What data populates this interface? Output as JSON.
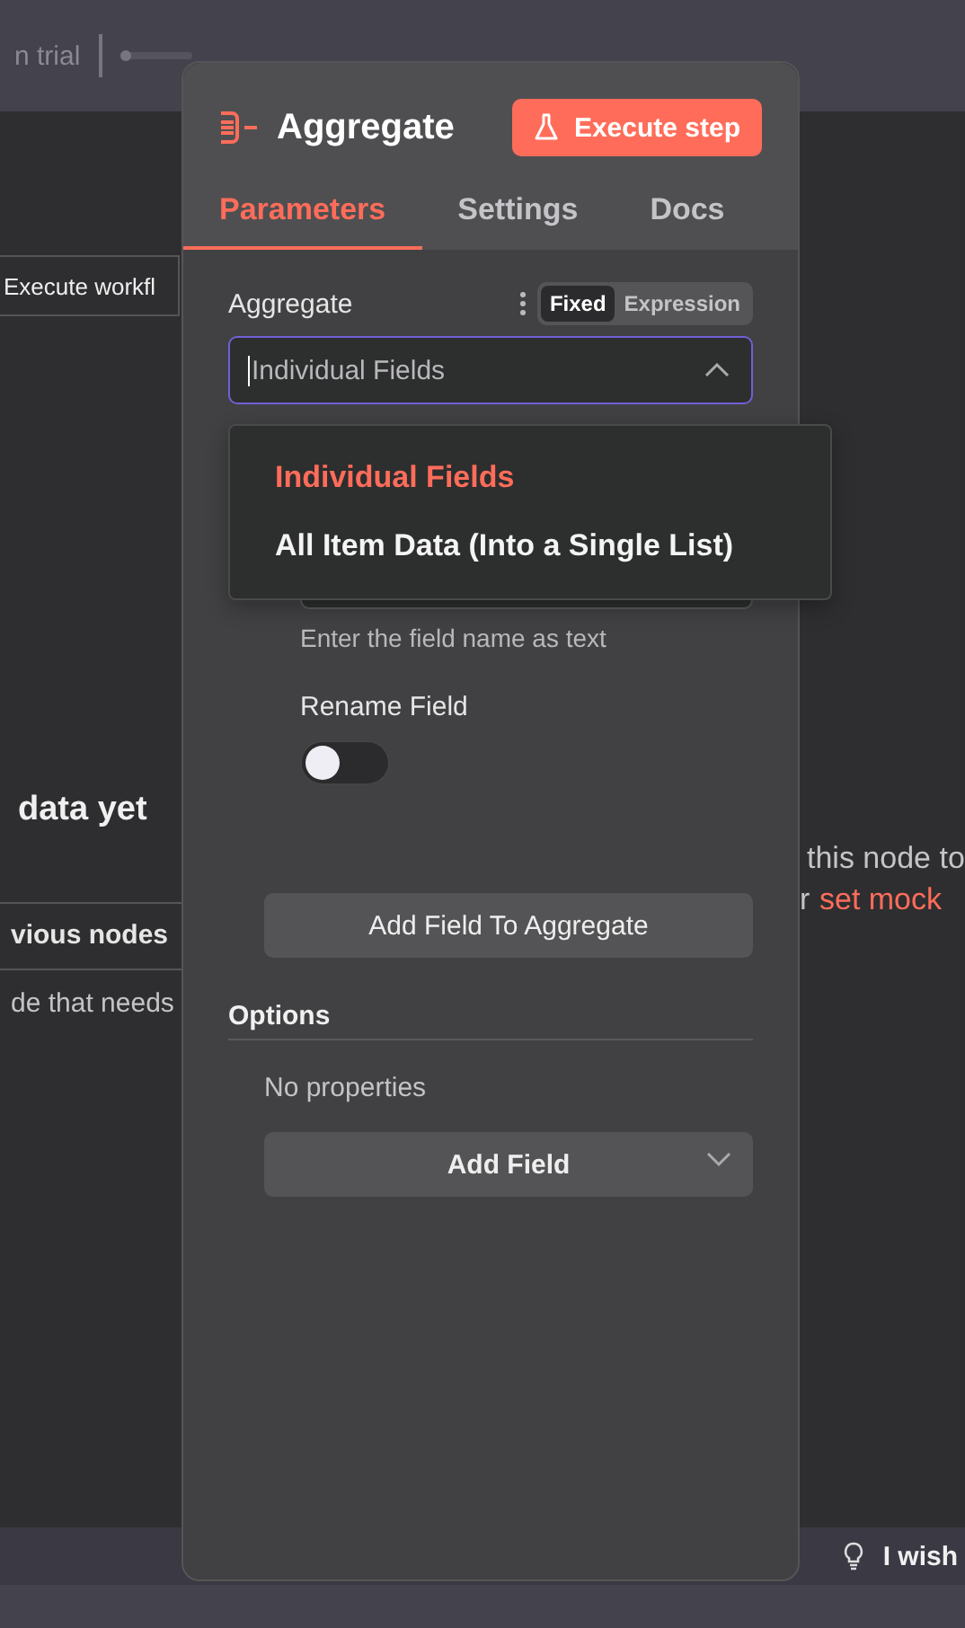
{
  "background": {
    "plan": "n trial",
    "execute_workflow": "Execute workfl",
    "no_data": "data yet",
    "previous_nodes": "vious nodes",
    "node_hint": "de that needs",
    "right_hint_1": "this node to",
    "right_hint_2_prefix": "r",
    "right_hint_2_link": "set mock",
    "feedback": "I wish"
  },
  "panel": {
    "title": "Aggregate",
    "execute_button": "Execute step",
    "tabs": [
      {
        "label": "Parameters",
        "selected": true
      },
      {
        "label": "Settings",
        "selected": false
      },
      {
        "label": "Docs",
        "selected": false
      }
    ],
    "aggregate": {
      "label": "Aggregate",
      "modes": [
        {
          "label": "Fixed",
          "selected": true
        },
        {
          "label": "Expression",
          "selected": false
        }
      ],
      "value": "Individual Fields",
      "expanded": true,
      "options": [
        {
          "label": "Individual Fields",
          "selected": true
        },
        {
          "label": "All Item Data (Into a Single List)",
          "selected": false
        }
      ]
    },
    "field_hint": "Enter the field name as text",
    "rename": {
      "label": "Rename Field",
      "on": false
    },
    "add_field_button": "Add Field To Aggregate",
    "options_section": {
      "title": "Options",
      "empty": "No properties",
      "add_button": "Add Field"
    }
  }
}
